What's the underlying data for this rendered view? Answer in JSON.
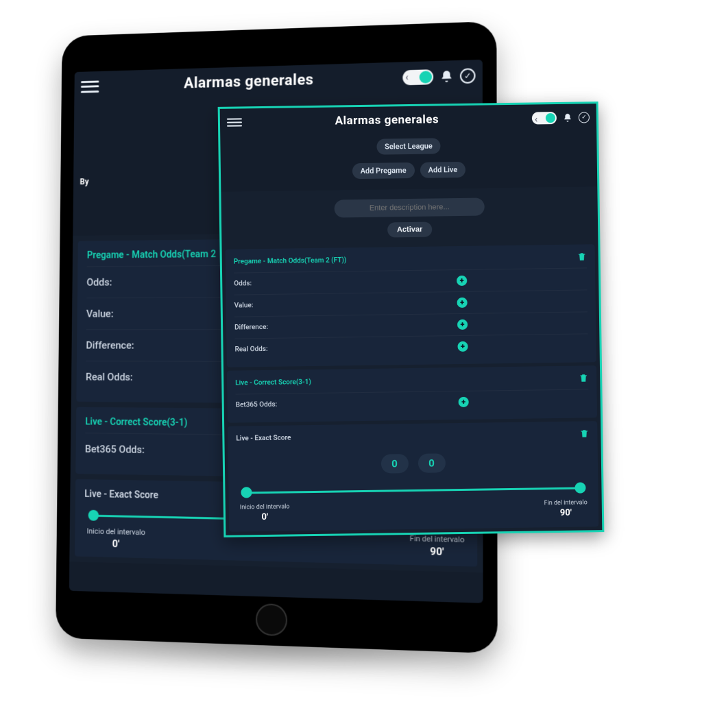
{
  "colors": {
    "accent": "#17d3b4",
    "bg_app": "#141d2b",
    "bg_card": "#18253a",
    "pill": "#2a3647"
  },
  "app": {
    "title": "Alarmas generales",
    "buttons": {
      "select_league": "Select League",
      "add_pregame": "Add Pregame",
      "add_live": "Add Live",
      "activar": "Activar"
    },
    "by_label": "By",
    "description_placeholder": "Enter description here..."
  },
  "cards": {
    "pregame": {
      "title_full": "Pregame - Match Odds(Team 2 (FT))",
      "title_short": "Pregame - Match Odds(Team 2",
      "rows": [
        {
          "label": "Odds:"
        },
        {
          "label": "Value:"
        },
        {
          "label": "Difference:"
        },
        {
          "label": "Real Odds:"
        }
      ]
    },
    "live_correct": {
      "title": "Live - Correct Score(3-1)",
      "rows": [
        {
          "label": "Bet365 Odds:"
        }
      ]
    },
    "live_exact": {
      "title": "Live - Exact Score",
      "scores": [
        "0",
        "0"
      ],
      "interval": {
        "start_label": "Inicio del intervalo",
        "end_label": "Fin del intervalo",
        "start_value": "0'",
        "end_value": "90'"
      }
    }
  }
}
